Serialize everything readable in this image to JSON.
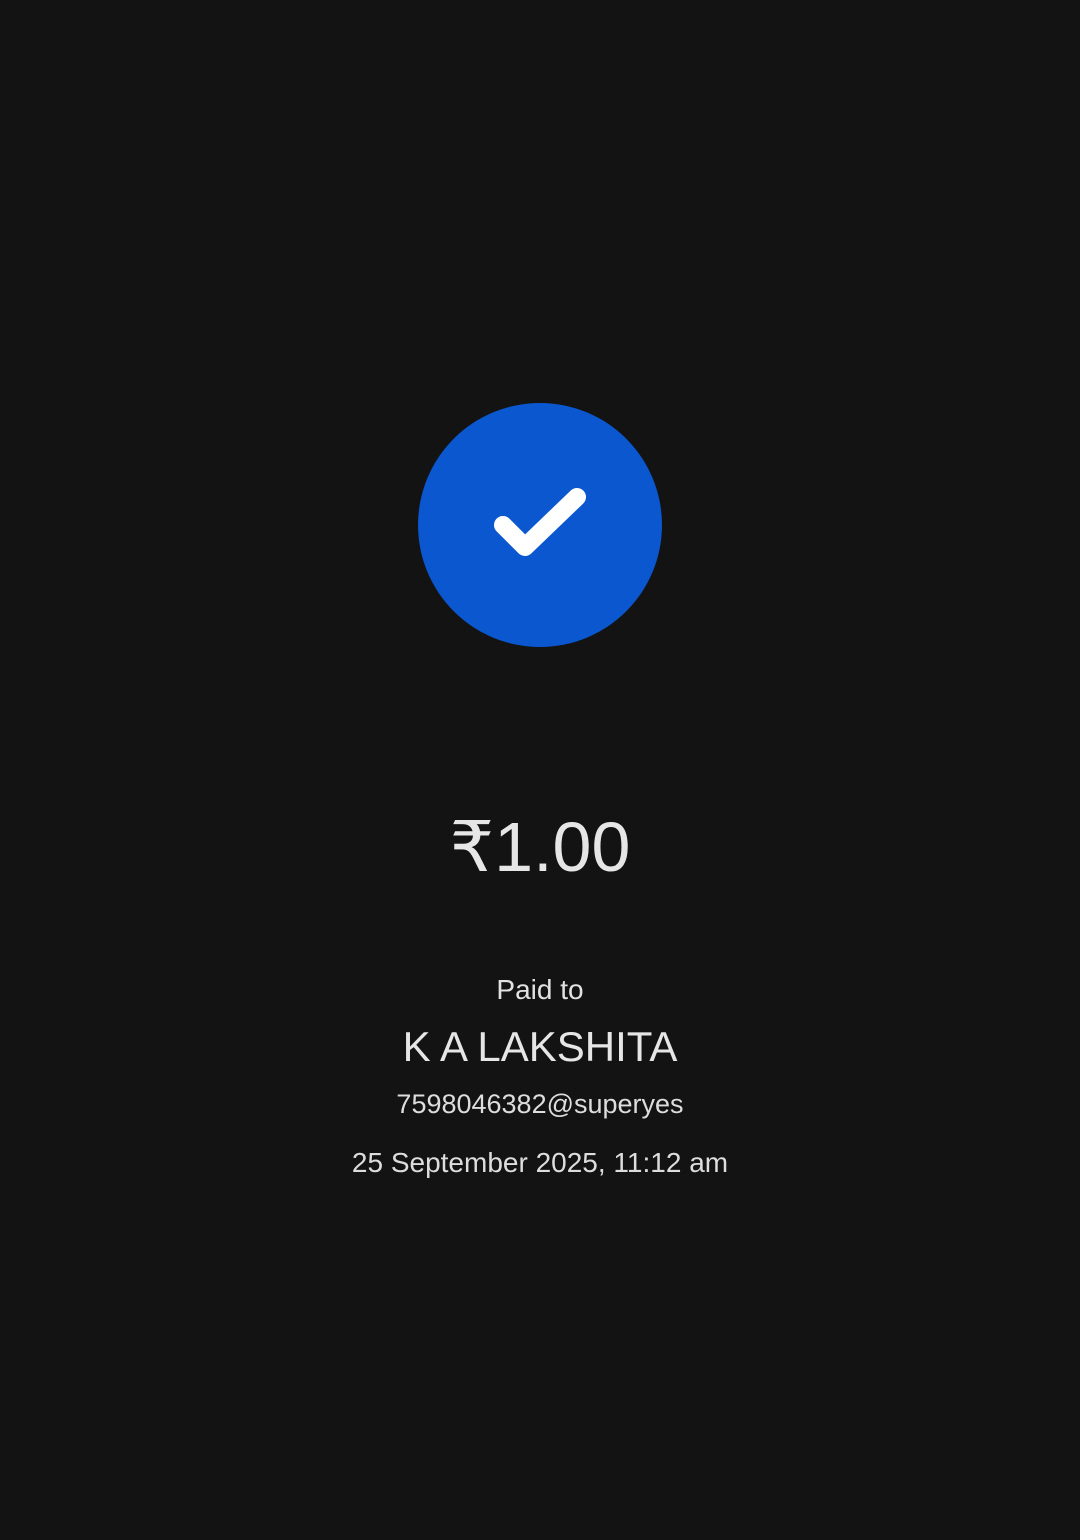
{
  "status": {
    "icon": "check-icon",
    "badge_color": "#0b57d0"
  },
  "payment": {
    "amount": "₹1.00",
    "paid_to_label": "Paid to",
    "payee_name": "K A LAKSHITA",
    "payee_upi": "7598046382@superyes",
    "datetime": "25 September 2025, 11:12 am"
  }
}
